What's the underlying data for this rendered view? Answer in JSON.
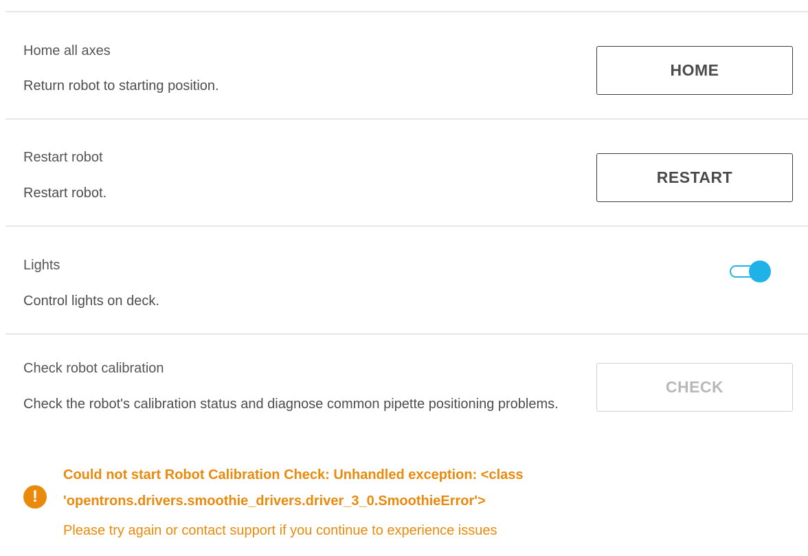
{
  "controls": [
    {
      "title": "Home all axes",
      "description": "Return robot to starting position.",
      "button_label": "HOME"
    },
    {
      "title": "Restart robot",
      "description": "Restart robot.",
      "button_label": "RESTART"
    },
    {
      "title": "Lights",
      "description": "Control lights on deck.",
      "toggle_on": true
    },
    {
      "title": "Check robot calibration",
      "description": "Check the robot's calibration status and diagnose common pipette positioning problems.",
      "button_label": "CHECK",
      "button_disabled": true
    }
  ],
  "error": {
    "icon": "exclamation-icon",
    "icon_glyph": "!",
    "title": "Could not start Robot Calibration Check: Unhandled exception: <class 'opentrons.drivers.smoothie_drivers.driver_3_0.SmoothieError'>",
    "message": "Please try again or contact support if you continue to experience issues"
  },
  "colors": {
    "accent": "#1eb2e8",
    "warning": "#e98a0d",
    "divider": "#e6e6e6",
    "text": "#4a4a4a"
  }
}
